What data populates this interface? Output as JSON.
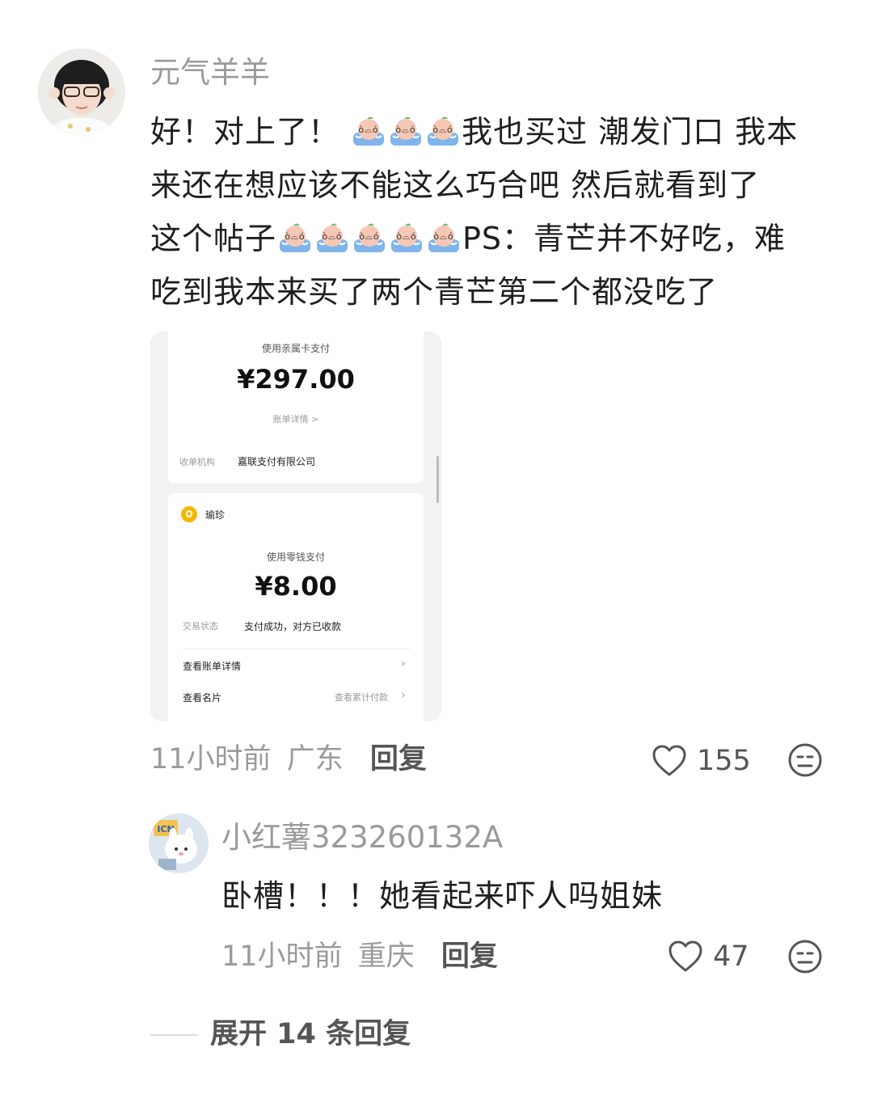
{
  "comment": {
    "username": "元气羊羊",
    "line1_a": "好！对上了！",
    "line1_b": "我也买过 潮发门口 我本",
    "line2": "来还在想应该不能这么巧合吧 然后就看到了",
    "line3_a": "这个帖子",
    "line3_b": "PS：青芒并不好吃，难",
    "line4": "吃到我本来买了两个青芒第二个都没吃了",
    "time": "11小时前",
    "location": "广东",
    "reply_label": "回复",
    "likes": "155"
  },
  "screenshot": {
    "top_method": "使用亲属卡支付",
    "top_amount": "¥297.00",
    "bill_detail": "账单详情 >",
    "merchant_label": "收单机构",
    "merchant_value": "嘉联支付有限公司",
    "payee_name": "瑜珍",
    "second_method": "使用零钱支付",
    "second_amount": "¥8.00",
    "status_label": "交易状态",
    "status_value": "支付成功，对方已收款",
    "view_bill": "查看账单详情",
    "view_card": "查看名片",
    "view_total": "查看累计付款"
  },
  "reply": {
    "username": "小红薯323260132A",
    "text": "卧槽！！！她看起来吓人吗姐妹",
    "time": "11小时前",
    "location": "重庆",
    "reply_label": "回复",
    "likes": "47"
  },
  "expand": {
    "label": "展开 14 条回复"
  },
  "colors": {
    "text_main": "#1f1f1f",
    "text_meta": "#9a9a9a",
    "background": "#ffffff",
    "card_bg": "#f2f2f2",
    "coin_yellow": "#f5b800"
  },
  "icons": [
    "heart-icon",
    "dissatisfied-face-icon",
    "crying-peach-emoji"
  ]
}
